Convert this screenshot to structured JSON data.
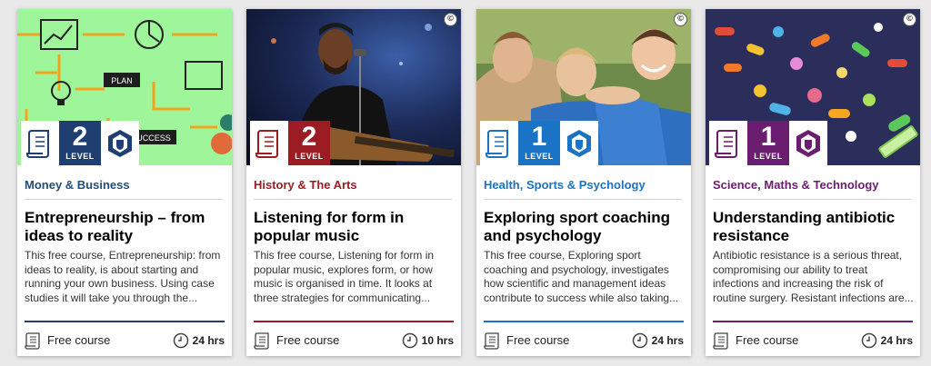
{
  "cards": [
    {
      "category": "Money & Business",
      "category_color": "#1f4e79",
      "level_number": "2",
      "level_word": "LEVEL",
      "level_color": "#1f3f73",
      "title": "Entrepreneurship – from ideas to reality",
      "description": "This free course, Entrepreneurship: from ideas to reality, is about starting and running your own business. Using case studies it will take you through the...",
      "course_type": "Free course",
      "duration": "24 hrs",
      "art_labels": [
        "PLAN",
        "SUCCESS"
      ]
    },
    {
      "category": "History & The Arts",
      "category_color": "#9b1c22",
      "level_number": "2",
      "level_word": "LEVEL",
      "level_color": "#9b1c22",
      "title": "Listening for form in popular music",
      "description": "This free course, Listening for form in popular music, explores form, or how music is organised in time. It looks at three strategies for communicating...",
      "course_type": "Free course",
      "duration": "10 hrs"
    },
    {
      "category": "Health, Sports & Psychology",
      "category_color": "#1a73c4",
      "level_number": "1",
      "level_word": "LEVEL",
      "level_color": "#1a73c4",
      "title": "Exploring sport coaching and psychology",
      "description": "This free course, Exploring sport coaching and psychology, investigates how scientific and management ideas contribute to success while also taking...",
      "course_type": "Free course",
      "duration": "24 hrs"
    },
    {
      "category": "Science, Maths & Technology",
      "category_color": "#6b1d6f",
      "level_number": "1",
      "level_word": "LEVEL",
      "level_color": "#6b1d6f",
      "title": "Understanding antibiotic resistance",
      "description": "Antibiotic resistance is a serious threat, compromising our ability to treat infections and increasing the risk of routine surgery. Resistant infections are...",
      "course_type": "Free course",
      "duration": "24 hrs"
    }
  ],
  "copyright_symbol": "©"
}
